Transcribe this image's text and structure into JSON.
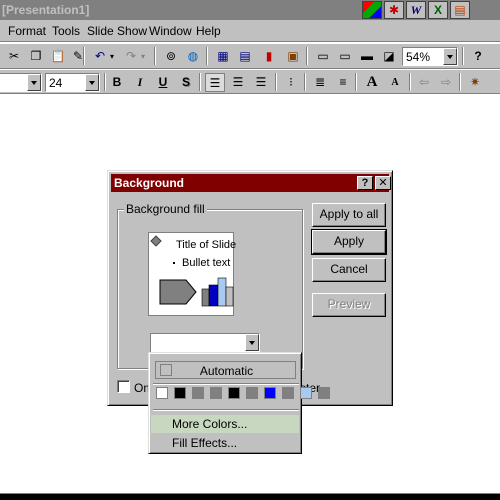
{
  "window": {
    "title": "[Presentation1]"
  },
  "title_icons": [
    "color-icon",
    "figure-icon",
    "word-icon",
    "excel-icon",
    "powerpoint-icon"
  ],
  "menu": [
    {
      "label": "Format"
    },
    {
      "label": "Tools"
    },
    {
      "label": "Slide Show"
    },
    {
      "label": "Window"
    },
    {
      "label": "Help"
    }
  ],
  "toolbar": {
    "zoom": "54%",
    "font_size": "24",
    "bold": "B",
    "italic": "I",
    "underline": "U",
    "shadow": "S",
    "grow_font": "A",
    "shrink_font": "A"
  },
  "dialog": {
    "title": "Background",
    "help": "?",
    "close": "✕",
    "group_label": "Background fill",
    "preview": {
      "slide_title": "Title of Slide",
      "bullet": "Bullet text"
    },
    "buttons": {
      "apply_all": "Apply to all",
      "apply": "Apply",
      "cancel": "Cancel",
      "preview": "Preview"
    },
    "omit_label": "Om",
    "omit_label_tail": "ster"
  },
  "popup": {
    "automatic": "Automatic",
    "swatches": [
      "#ffffff",
      "#000000",
      "#808080",
      "#808080",
      "#000000",
      "#808080",
      "#0000ff",
      "#808080",
      "#a6caf0",
      "#808080"
    ],
    "more_colors": "More Colors...",
    "fill_effects": "Fill Effects..."
  }
}
